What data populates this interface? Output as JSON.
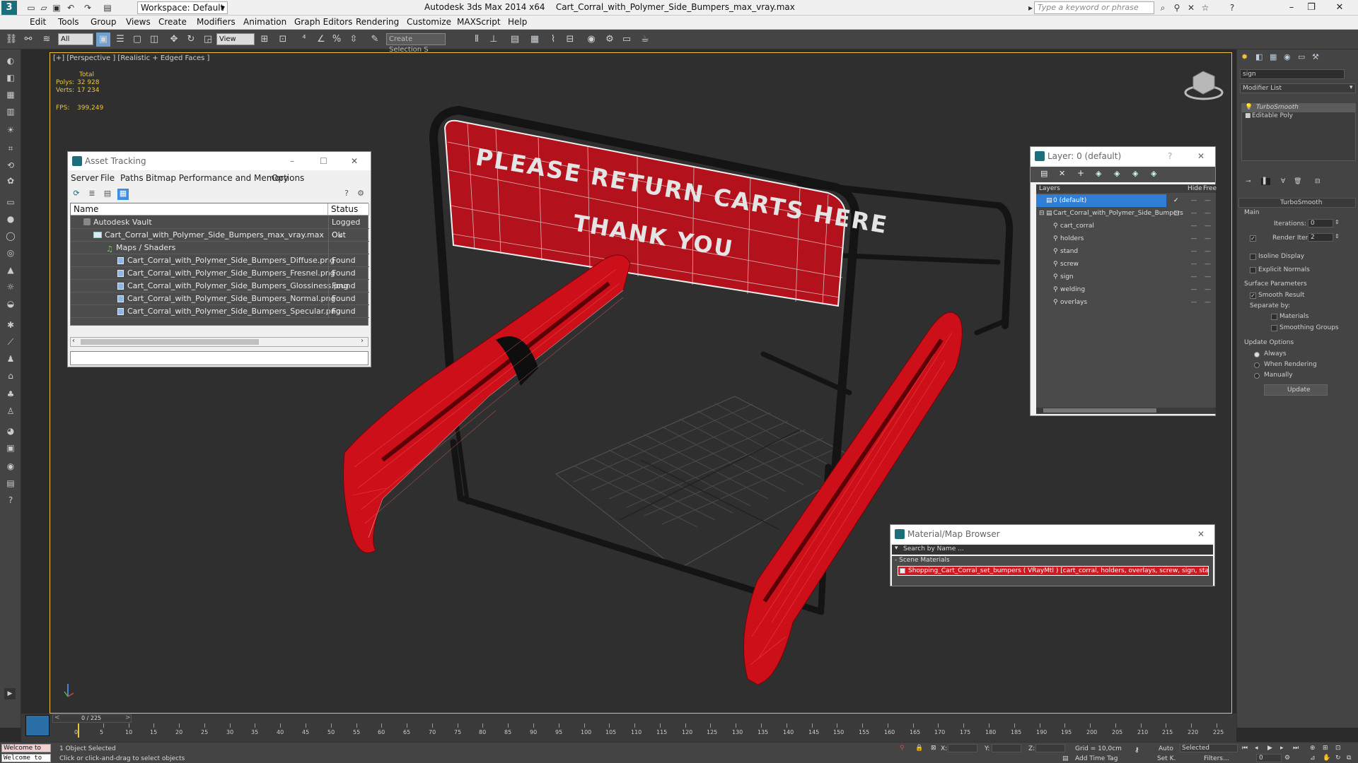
{
  "titlebar": {
    "logo": "3",
    "workspace": "Workspace: Default",
    "app_title": "Autodesk 3ds Max  2014 x64",
    "file_name": "Cart_Corral_with_Polymer_Side_Bumpers_max_vray.max",
    "search_placeholder": "Type a keyword or phrase"
  },
  "menubar": [
    "Edit",
    "Tools",
    "Group",
    "Views",
    "Create",
    "Modifiers",
    "Animation",
    "Graph Editors",
    "Rendering",
    "Customize",
    "MAXScript",
    "Help"
  ],
  "toolbar": {
    "filter_value": "All",
    "view_value": "View",
    "selection_set": "Create Selection S"
  },
  "viewport": {
    "label": "[+] [Perspective ] [Realistic + Edged Faces ]",
    "stats": {
      "total_label": "Total",
      "polys_label": "Polys:",
      "polys": "32 928",
      "verts_label": "Verts:",
      "verts": "17 234",
      "fps_label": "FPS:",
      "fps": "399,249"
    },
    "sign_line1": "PLEASE RETURN CARTS HERE",
    "sign_line2": "THANK YOU"
  },
  "asset_tracking": {
    "title": "Asset Tracking",
    "menu": [
      "Server",
      "File",
      "Paths",
      "Bitmap Performance and Memory",
      "Options"
    ],
    "col_name": "Name",
    "col_status": "Status",
    "rows": [
      {
        "name": "Autodesk Vault",
        "status": "Logged Out"
      },
      {
        "name": "Cart_Corral_with_Polymer_Side_Bumpers_max_vray.max",
        "status": "Ok"
      },
      {
        "name": "Maps / Shaders",
        "status": ""
      },
      {
        "name": "Cart_Corral_with_Polymer_Side_Bumpers_Diffuse.png",
        "status": "Found"
      },
      {
        "name": "Cart_Corral_with_Polymer_Side_Bumpers_Fresnel.png",
        "status": "Found"
      },
      {
        "name": "Cart_Corral_with_Polymer_Side_Bumpers_Glossiness.png",
        "status": "Found"
      },
      {
        "name": "Cart_Corral_with_Polymer_Side_Bumpers_Normal.png",
        "status": "Found"
      },
      {
        "name": "Cart_Corral_with_Polymer_Side_Bumpers_Specular.png",
        "status": "Found"
      }
    ]
  },
  "layer_panel": {
    "title": "Layer: 0 (default)",
    "help": "?",
    "col_layers": "Layers",
    "col_hide": "Hide",
    "col_freeze": "Free",
    "items": [
      {
        "name": "0 (default)",
        "selected": true
      },
      {
        "name": "Cart_Corral_with_Polymer_Side_Bumpers",
        "selected": false
      },
      {
        "name": "cart_corral",
        "selected": false
      },
      {
        "name": "holders",
        "selected": false
      },
      {
        "name": "stand",
        "selected": false
      },
      {
        "name": "screw",
        "selected": false
      },
      {
        "name": "sign",
        "selected": false
      },
      {
        "name": "welding",
        "selected": false
      },
      {
        "name": "overlays",
        "selected": false
      }
    ]
  },
  "material_browser": {
    "title": "Material/Map Browser",
    "search_placeholder": "Search by Name ...",
    "section": "- Scene Materials",
    "material": "Shopping_Cart_Corral_set_bumpers  ( VRayMtl ) [cart_corral, holders, overlays, screw, sign, stand, welding]"
  },
  "command_panel": {
    "object_name": "sign",
    "modifier_list": "Modifier List",
    "stack": [
      "TurboSmooth",
      "Editable Poly"
    ],
    "rollout_title": "TurboSmooth",
    "main": "Main",
    "iterations_label": "Iterations:",
    "iterations": "0",
    "render_iters_label": "Render Iters:",
    "render_iters": "2",
    "isoline": "Isoline Display",
    "explicit_normals": "Explicit Normals",
    "surface_params": "Surface Parameters",
    "smooth_result": "Smooth Result",
    "separate_by": "Separate by:",
    "materials": "Materials",
    "smoothing_groups": "Smoothing Groups",
    "update_options": "Update Options",
    "always": "Always",
    "when_rendering": "When Rendering",
    "manually": "Manually",
    "update_button": "Update"
  },
  "timeline": {
    "frame_counter": "0 / 225",
    "ticks": [
      "0",
      "5",
      "10",
      "15",
      "20",
      "25",
      "30",
      "35",
      "40",
      "45",
      "50",
      "55",
      "60",
      "65",
      "70",
      "75",
      "80",
      "85",
      "90",
      "95",
      "100",
      "105",
      "110",
      "115",
      "120",
      "125",
      "130",
      "135",
      "140",
      "145",
      "150",
      "155",
      "160",
      "165",
      "170",
      "175",
      "180",
      "185",
      "190",
      "195",
      "200",
      "205",
      "210",
      "215",
      "220",
      "225"
    ]
  },
  "statusbar": {
    "welcome": "Welcome to",
    "selected": "1 Object Selected",
    "hint": "Click or click-and-drag to select objects",
    "x_label": "X:",
    "y_label": "Y:",
    "z_label": "Z:",
    "grid": "Grid = 10,0cm",
    "add_time_tag": "Add Time Tag",
    "auto": "Auto",
    "set_key": "Set K.",
    "selected_mode": "Selected",
    "filters": "Filters...",
    "frame": "0"
  },
  "icons": [
    "search-icon",
    "gear-icon",
    "star-icon",
    "help-icon",
    "close-icon",
    "minimize-icon",
    "maximize-icon",
    "viewcube-icon",
    "axis-gizmo-icon",
    "play-icon"
  ]
}
